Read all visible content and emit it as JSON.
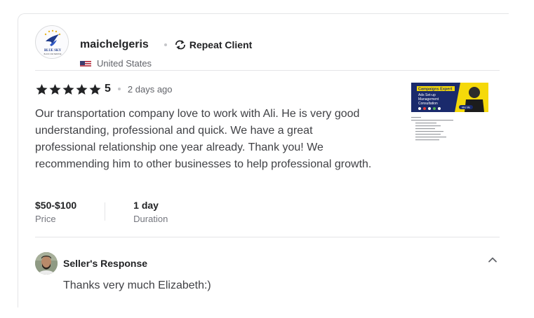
{
  "reviewer": {
    "username": "maichelgeris",
    "badge": "Repeat Client",
    "country": "United States",
    "avatar_text": "BLUE SKY",
    "avatar_subtext": "BLACK CAR SERVICE"
  },
  "review": {
    "rating": "5",
    "stars": 5,
    "date": "2 days ago",
    "text": "Our transportation company love to work with Ali. He is very good understanding, professional and quick. We have a great professional relationship one year already. Thank you! We recommending him to other businesses to help professional growth.",
    "price_value": "$50-$100",
    "price_label": "Price",
    "duration_value": "1 day",
    "duration_label": "Duration"
  },
  "thumbnail": {
    "banner_title": "Campaigns Expert",
    "bullets": [
      "Ads Set-up",
      "Management",
      "Consultation"
    ],
    "button": "Hire Me",
    "accent_color": "#f5d90a",
    "navy_color": "#1a2a6c"
  },
  "seller_response": {
    "title": "Seller's Response",
    "text": "Thanks very much Elizabeth:)"
  },
  "colors": {
    "star": "#222325",
    "text": "#404145",
    "muted": "#62646a",
    "divider": "#e4e5e7"
  }
}
